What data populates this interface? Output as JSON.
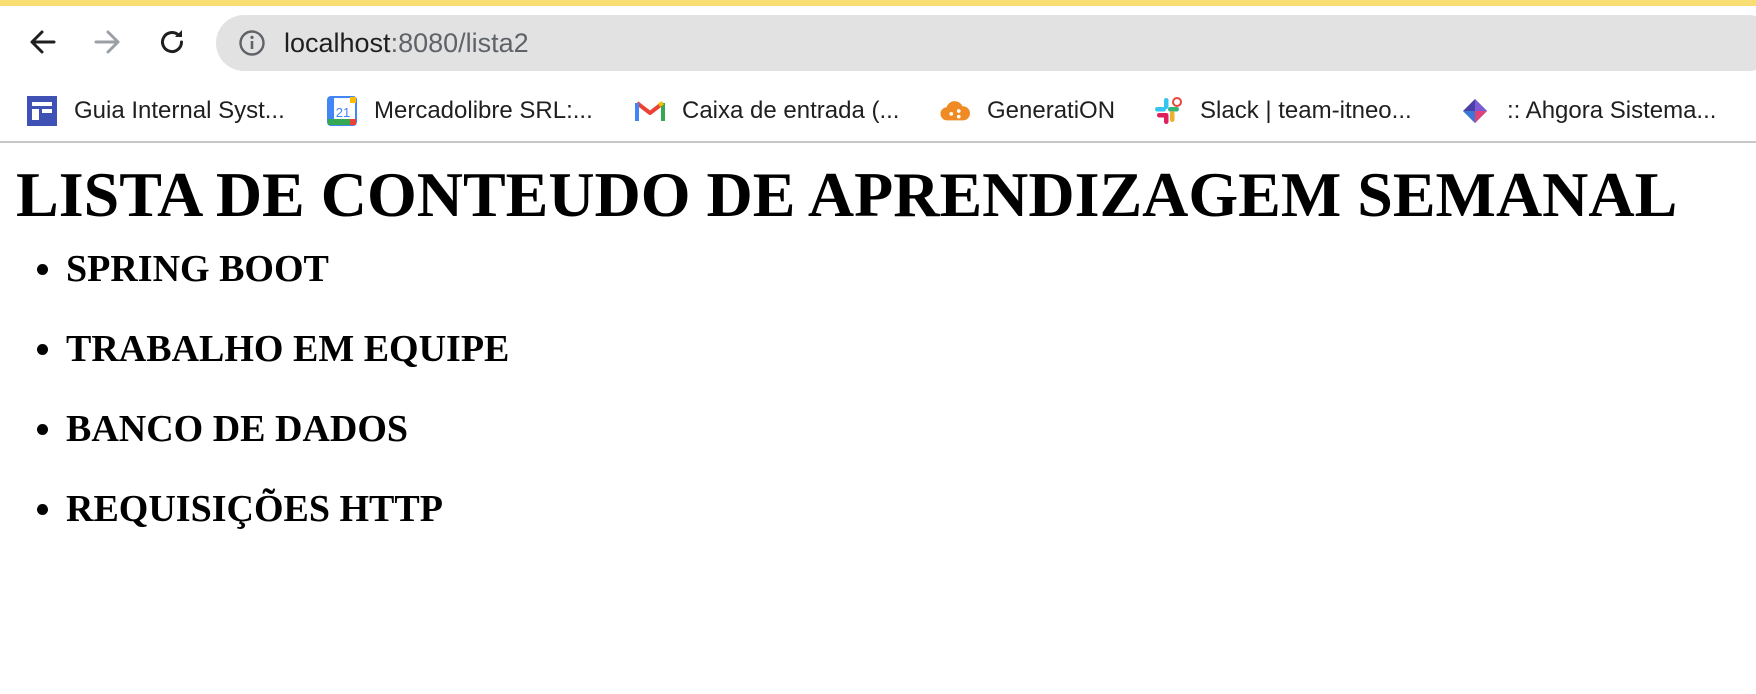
{
  "browser": {
    "url_host": "localhost",
    "url_rest": ":8080/lista2",
    "nav": {
      "back_icon": "arrow-left-icon",
      "forward_icon": "arrow-right-icon",
      "reload_icon": "reload-icon"
    },
    "bookmarks": [
      {
        "label": "Guia Internal Syst...",
        "icon": "calendar-layout-icon"
      },
      {
        "label": "Mercadolibre SRL:...",
        "icon": "google-calendar-icon"
      },
      {
        "label": "Caixa de entrada (...",
        "icon": "gmail-icon"
      },
      {
        "label": "GeneratiON",
        "icon": "cloud-icon"
      },
      {
        "label": "Slack | team-itneo...",
        "icon": "slack-icon"
      },
      {
        "label": ":: Ahgora Sistema...",
        "icon": "ahgora-icon"
      }
    ]
  },
  "page": {
    "title": "LISTA DE CONTEUDO DE APRENDIZAGEM SEMANAL",
    "items": [
      "SPRING BOOT",
      "TRABALHO EM EQUIPE",
      "BANCO DE DADOS",
      "REQUISIÇÕES HTTP"
    ]
  },
  "colors": {
    "top_stripe": "#f7dd72",
    "omnibox_bg": "#e2e2e2"
  }
}
